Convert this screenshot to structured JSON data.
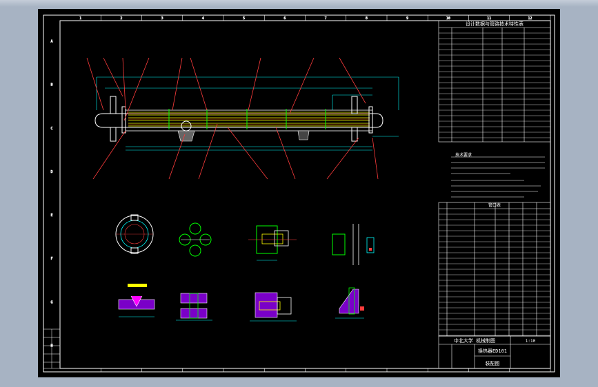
{
  "drawing": {
    "title": "设计数据与管路技术特性表",
    "university": "中北大学 机械制图",
    "part_name": "换热器ED101",
    "drawing_type": "装配图",
    "scale": "1:10",
    "notes_title": "技术要求",
    "parts_list_title": "管口表"
  },
  "frame_marks": {
    "top": [
      "1",
      "2",
      "3",
      "4",
      "5",
      "6",
      "7",
      "8",
      "9",
      "10",
      "11",
      "12"
    ],
    "side": [
      "A",
      "B",
      "C",
      "D",
      "E",
      "F",
      "G",
      "H"
    ]
  },
  "colors": {
    "background": "#000000",
    "outline": "#ffffff",
    "shell": "#00ff00",
    "leader": "#ff3c3c",
    "tubes": "#ffff00",
    "hatch": "#b400ff",
    "dimension": "#00ffff"
  }
}
